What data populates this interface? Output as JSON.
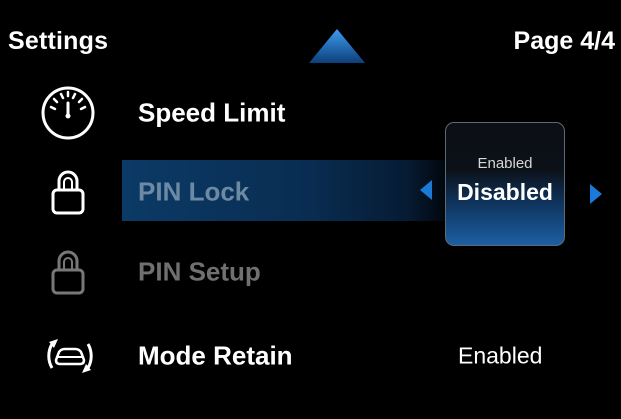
{
  "header": {
    "title": "Settings",
    "page_indicator": "Page 4/4"
  },
  "items": [
    {
      "label": "Speed Limit",
      "icon": "speedometer-icon",
      "value": ""
    },
    {
      "label": "PIN Lock",
      "icon": "padlock-icon",
      "value": ""
    },
    {
      "label": "PIN Setup",
      "icon": "padlock-icon",
      "value": ""
    },
    {
      "label": "Mode Retain",
      "icon": "mode-retain-icon",
      "value": "Enabled"
    }
  ],
  "selected_item": "PIN Lock",
  "selector_popup": {
    "previous_option": "Enabled",
    "current_option": "Disabled"
  },
  "colors": {
    "background": "#000000",
    "accent": "#1a7ad8",
    "selected_row": "#0b3a66",
    "disabled_text": "#707070"
  }
}
